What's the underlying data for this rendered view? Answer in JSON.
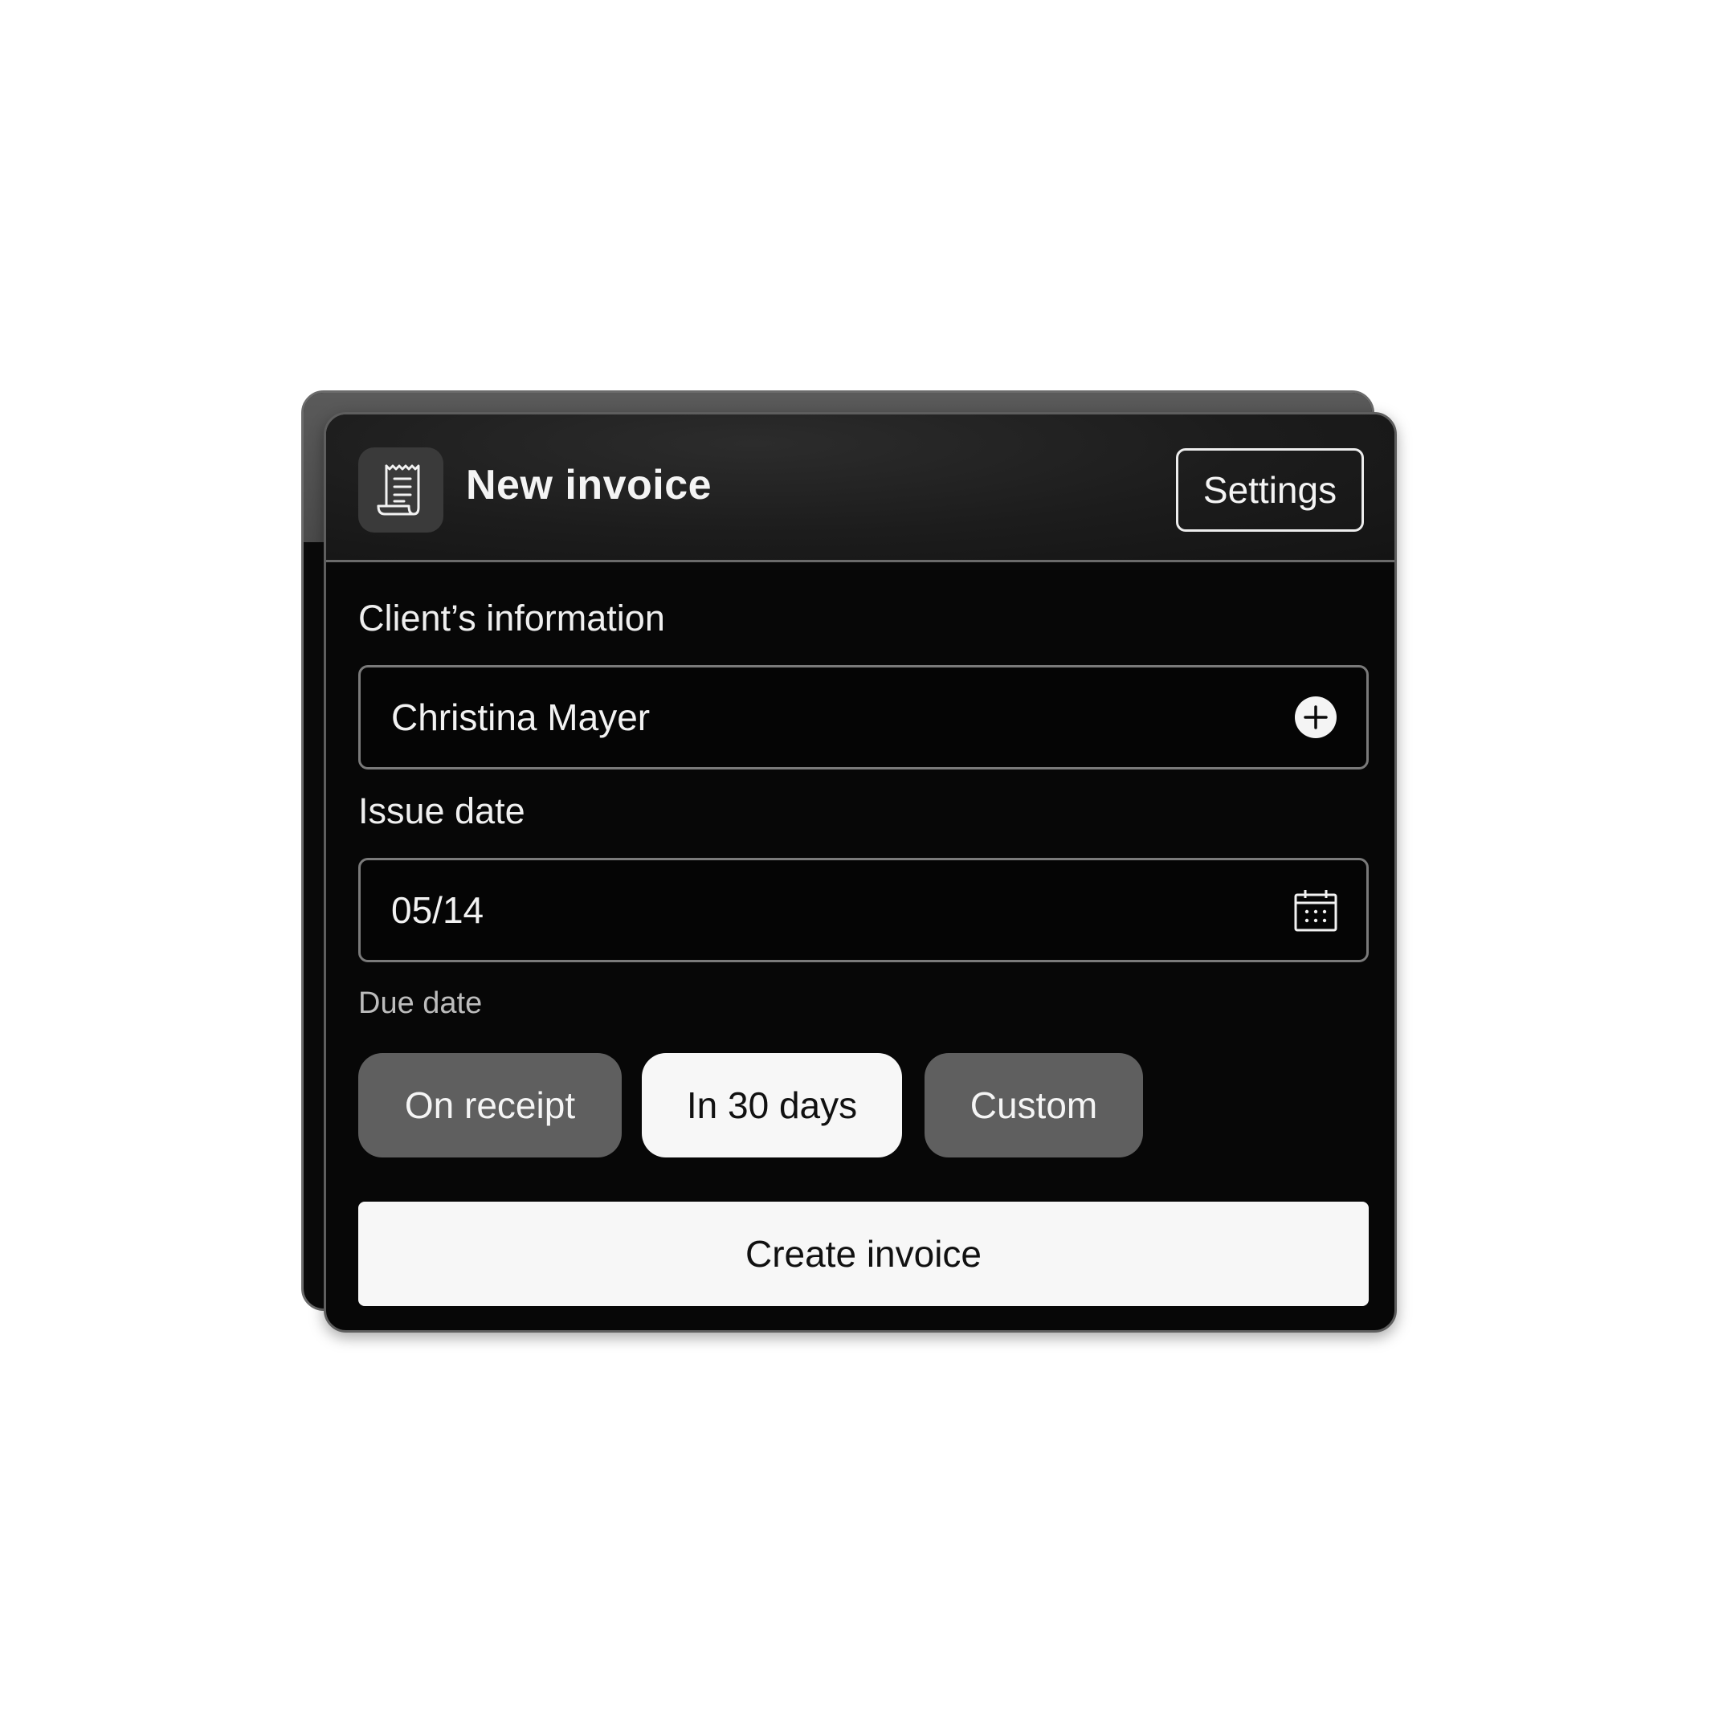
{
  "header": {
    "title": "New invoice",
    "icon": "receipt-icon",
    "settings_label": "Settings"
  },
  "client": {
    "label": "Client’s information",
    "value": "Christina Mayer",
    "action_icon": "plus-circle-icon"
  },
  "issue_date": {
    "label": "Issue date",
    "value": "05/14",
    "action_icon": "calendar-icon"
  },
  "due_date": {
    "label": "Due date",
    "options": [
      {
        "label": "On receipt",
        "selected": false
      },
      {
        "label": "In 30 days",
        "selected": true
      },
      {
        "label": "Custom",
        "selected": false
      }
    ]
  },
  "actions": {
    "create_label": "Create invoice"
  },
  "colors": {
    "card_bg": "#070707",
    "header_bg": "#1c1c1c",
    "chip_inactive": "#5f5f5f",
    "chip_active": "#f7f7f7",
    "button_bg": "#f7f7f7"
  }
}
